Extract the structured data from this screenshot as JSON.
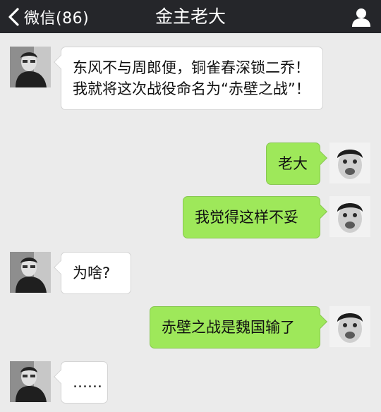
{
  "header": {
    "back_label": "微信(86)",
    "title": "金主老大"
  },
  "colors": {
    "header_bg": "#25262a",
    "chat_bg": "#ebebeb",
    "sent_bubble": "#9ee85a",
    "received_bubble": "#ffffff"
  },
  "messages": [
    {
      "sender": "other",
      "text": "东风不与周郎便，铜雀春深锁二乔！我就将这次战役命名为“赤壁之战”！"
    },
    {
      "sender": "me",
      "text": "老大"
    },
    {
      "sender": "me",
      "text": "我觉得这样不妥"
    },
    {
      "sender": "other",
      "text": "为啥?"
    },
    {
      "sender": "me",
      "text": "赤壁之战是魏国输了"
    },
    {
      "sender": "other",
      "text": "……"
    }
  ]
}
